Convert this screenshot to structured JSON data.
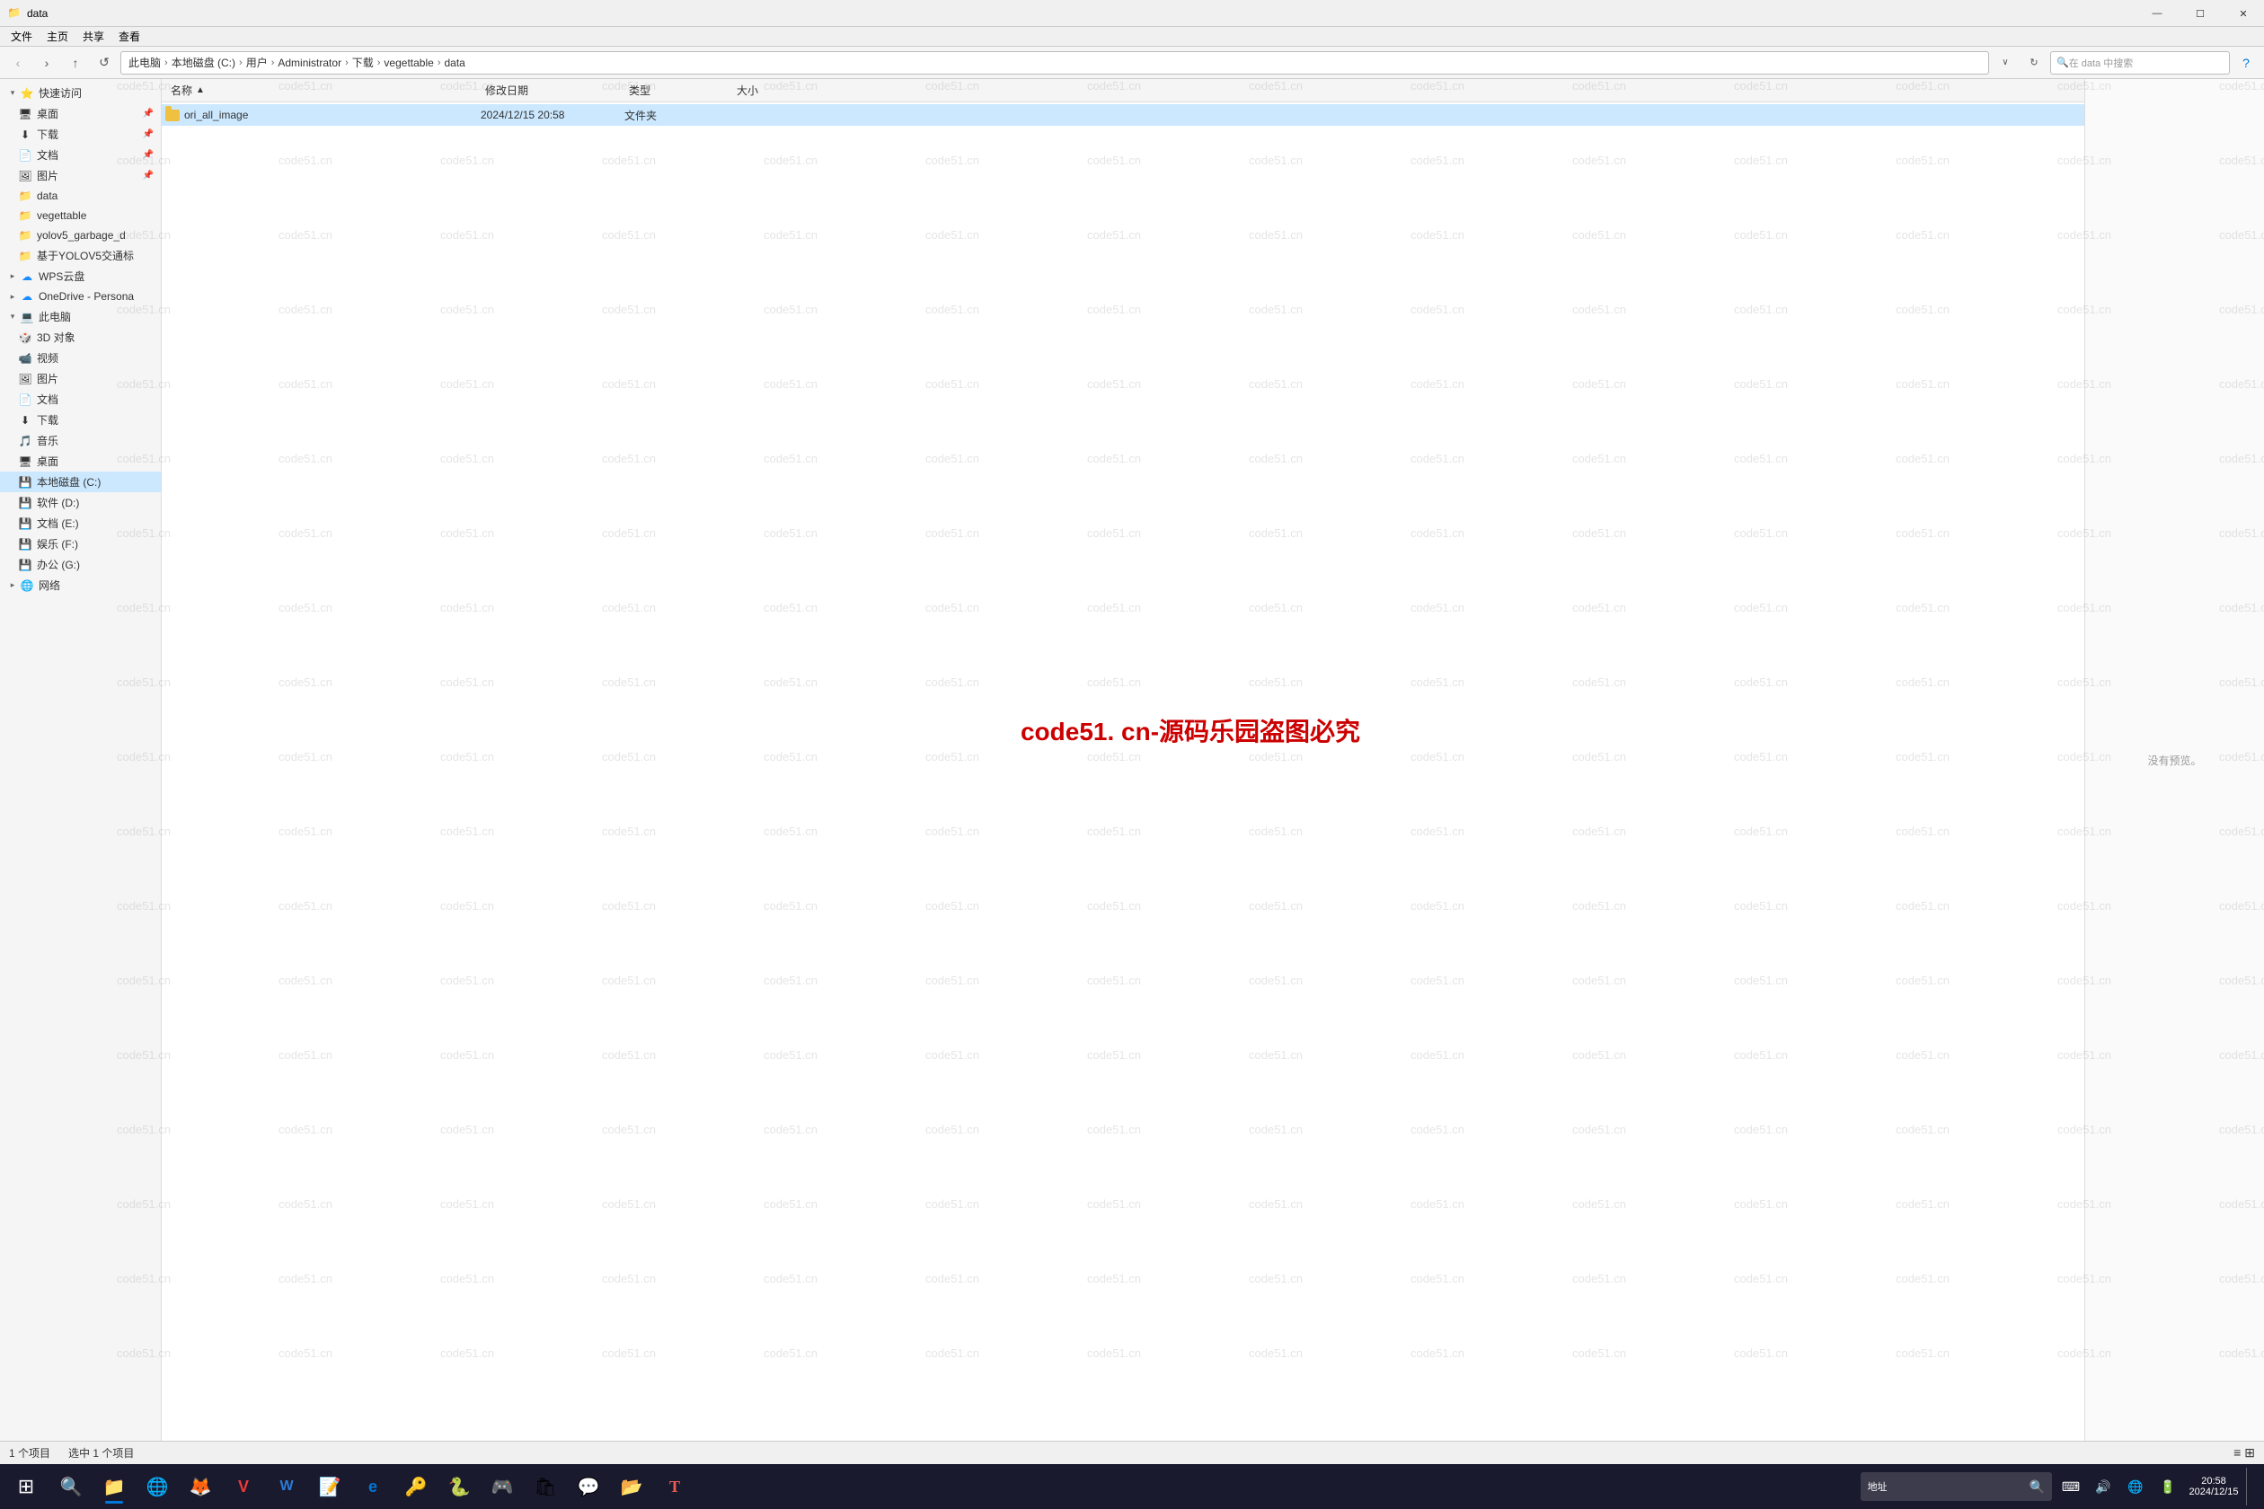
{
  "titlebar": {
    "title": "data",
    "icon": "📁",
    "minimize": "—",
    "maximize": "☐",
    "close": "✕"
  },
  "menubar": {
    "items": [
      "文件",
      "主页",
      "共享",
      "查看"
    ]
  },
  "navbar": {
    "back": "‹",
    "forward": "›",
    "up": "↑",
    "refresh_icon": "↻",
    "address": {
      "parts": [
        "此电脑",
        "本地磁盘 (C:)",
        "用户",
        "Administrator",
        "下载",
        "vegettable",
        "data"
      ],
      "separator": "›"
    },
    "search_placeholder": "在 data 中搜索",
    "collapse_icon": "∨",
    "refresh_btn": "↺"
  },
  "columns": {
    "name": "名称",
    "date_modified": "修改日期",
    "type": "类型",
    "size": "大小"
  },
  "files": [
    {
      "name": "ori_all_image",
      "date": "2024/12/15 20:58",
      "type": "文件夹",
      "size": "",
      "selected": true
    }
  ],
  "preview": {
    "text": "没有预览。"
  },
  "statusbar": {
    "count": "1 个项目",
    "selected": "选中 1 个项目"
  },
  "sidebar": {
    "sections": [
      {
        "id": "quick-access",
        "icon": "⭐",
        "label": "快速访问",
        "items": [
          {
            "id": "desktop",
            "icon": "🖥",
            "label": "桌面",
            "pinned": true
          },
          {
            "id": "downloads",
            "icon": "⬇",
            "label": "下载",
            "pinned": true
          },
          {
            "id": "documents",
            "icon": "📄",
            "label": "文档",
            "pinned": true
          },
          {
            "id": "pictures",
            "icon": "🖼",
            "label": "图片",
            "pinned": true
          },
          {
            "id": "data",
            "icon": "📁",
            "label": "data"
          },
          {
            "id": "vegettable",
            "icon": "📁",
            "label": "vegettable"
          },
          {
            "id": "yolov5_garbage_d",
            "icon": "📁",
            "label": "yolov5_garbage_d"
          },
          {
            "id": "jiyu_yolov5",
            "icon": "📁",
            "label": "基于YOLOV5交通标"
          }
        ]
      },
      {
        "id": "wps",
        "icon": "☁",
        "label": "WPS云盘"
      },
      {
        "id": "onedrive",
        "icon": "☁",
        "label": "OneDrive - Persona"
      },
      {
        "id": "this-pc",
        "icon": "💻",
        "label": "此电脑",
        "items": [
          {
            "id": "3d-objects",
            "icon": "🎲",
            "label": "3D 对象"
          },
          {
            "id": "videos",
            "icon": "📹",
            "label": "视频"
          },
          {
            "id": "pictures2",
            "icon": "🖼",
            "label": "图片"
          },
          {
            "id": "documents2",
            "icon": "📄",
            "label": "文档"
          },
          {
            "id": "downloads2",
            "icon": "⬇",
            "label": "下载"
          },
          {
            "id": "music",
            "icon": "🎵",
            "label": "音乐"
          },
          {
            "id": "desktop2",
            "icon": "🖥",
            "label": "桌面"
          },
          {
            "id": "local-c",
            "icon": "💾",
            "label": "本地磁盘 (C:)",
            "selected": true
          },
          {
            "id": "software-d",
            "icon": "💾",
            "label": "软件 (D:)"
          },
          {
            "id": "documents-e",
            "icon": "💾",
            "label": "文档 (E:)"
          },
          {
            "id": "entertainment-f",
            "icon": "💾",
            "label": "娱乐 (F:)"
          },
          {
            "id": "office-g",
            "icon": "💾",
            "label": "办公 (G:)"
          }
        ]
      },
      {
        "id": "network",
        "icon": "🌐",
        "label": "网络"
      }
    ]
  },
  "taskbar": {
    "start_icon": "⊞",
    "apps": [
      {
        "id": "search",
        "icon": "🔍",
        "active": false
      },
      {
        "id": "explorer",
        "icon": "📁",
        "active": true
      },
      {
        "id": "chrome",
        "icon": "🌐",
        "active": false
      },
      {
        "id": "firefox",
        "icon": "🦊",
        "active": false
      },
      {
        "id": "vivaldi",
        "icon": "V",
        "active": false
      },
      {
        "id": "word",
        "icon": "W",
        "active": false
      },
      {
        "id": "notes",
        "icon": "📝",
        "active": false
      },
      {
        "id": "edge",
        "icon": "e",
        "active": false
      },
      {
        "id": "kepass",
        "icon": "🔑",
        "active": false
      },
      {
        "id": "pycharm",
        "icon": "🐍",
        "active": false
      },
      {
        "id": "app1",
        "icon": "🎮",
        "active": false
      },
      {
        "id": "store",
        "icon": "🛍",
        "active": false
      },
      {
        "id": "wechat",
        "icon": "💬",
        "active": false
      },
      {
        "id": "files2",
        "icon": "📂",
        "active": false
      },
      {
        "id": "typora",
        "icon": "T",
        "active": false
      }
    ],
    "tray": {
      "address_label": "地址",
      "address_placeholder": "",
      "icons": [
        "⌨",
        "🔊",
        "🔋",
        "🌐",
        "🕐"
      ],
      "time": "20:58",
      "date": "2024/12/15"
    }
  },
  "watermark": {
    "text": "code51.cn",
    "red_text": "code51. cn-源码乐园盗图必究"
  }
}
